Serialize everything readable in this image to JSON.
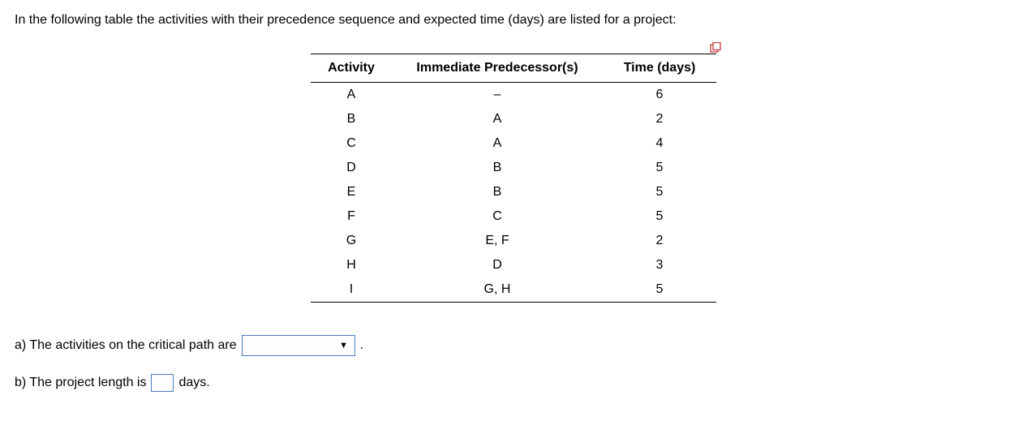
{
  "intro": "In the following table the activities with their precedence sequence and expected time (days) are listed for a project:",
  "table": {
    "headers": [
      "Activity",
      "Immediate Predecessor(s)",
      "Time (days)"
    ],
    "rows": [
      {
        "activity": "A",
        "predecessor": "–",
        "time": "6"
      },
      {
        "activity": "B",
        "predecessor": "A",
        "time": "2"
      },
      {
        "activity": "C",
        "predecessor": "A",
        "time": "4"
      },
      {
        "activity": "D",
        "predecessor": "B",
        "time": "5"
      },
      {
        "activity": "E",
        "predecessor": "B",
        "time": "5"
      },
      {
        "activity": "F",
        "predecessor": "C",
        "time": "5"
      },
      {
        "activity": "G",
        "predecessor": "E, F",
        "time": "2"
      },
      {
        "activity": "H",
        "predecessor": "D",
        "time": "3"
      },
      {
        "activity": "I",
        "predecessor": "G, H",
        "time": "5"
      }
    ]
  },
  "question_a": {
    "prefix": "a) The activities on the critical path are",
    "suffix": "."
  },
  "question_b": {
    "prefix": "b) The project length is",
    "suffix": "days."
  }
}
